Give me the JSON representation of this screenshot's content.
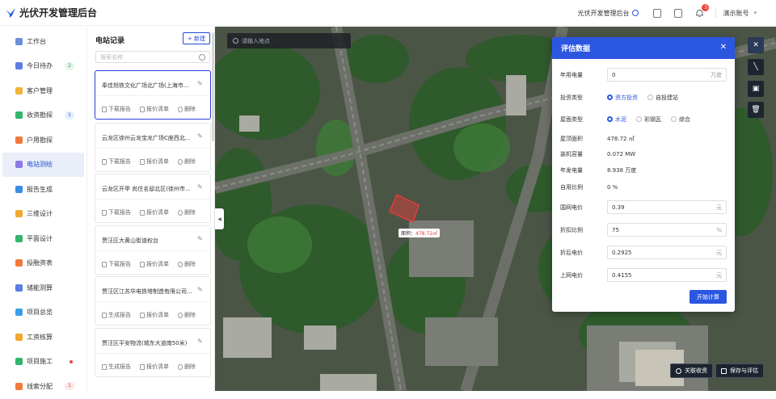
{
  "header": {
    "app_title": "光伏开发管理后台",
    "link_label": "光伏开发管理后台",
    "notification_count": "3",
    "user_name": "演示账号"
  },
  "sidebar": {
    "items": [
      {
        "label": "工作台",
        "color": "#6c8ed8",
        "badge": ""
      },
      {
        "label": "今日待办",
        "color": "#5b7ee6",
        "badge": "2",
        "badge_kind": "green"
      },
      {
        "label": "客户管理",
        "color": "#f0b33a",
        "badge": ""
      },
      {
        "label": "收资勘探",
        "color": "#35b56a",
        "badge": "1",
        "badge_kind": "blue"
      },
      {
        "label": "户用勘探",
        "color": "#f07a3a",
        "badge": ""
      },
      {
        "label": "电站测绘",
        "color": "#8a7be6",
        "badge": "",
        "active": true
      },
      {
        "label": "报告生成",
        "color": "#3a8ee6",
        "badge": ""
      },
      {
        "label": "三维设计",
        "color": "#f0a830",
        "badge": ""
      },
      {
        "label": "平面设计",
        "color": "#35b56a",
        "badge": ""
      },
      {
        "label": "投融资表",
        "color": "#f07a3a",
        "badge": ""
      },
      {
        "label": "储能测算",
        "color": "#5b7ee6",
        "badge": ""
      },
      {
        "label": "项目总览",
        "color": "#3aa0e6",
        "badge": ""
      },
      {
        "label": "工资核算",
        "color": "#f0a830",
        "badge": ""
      },
      {
        "label": "项目施工",
        "color": "#35b56a",
        "badge": "",
        "dot": true
      },
      {
        "label": "线索分配",
        "color": "#f07a3a",
        "badge": "1",
        "badge_kind": "red"
      }
    ]
  },
  "records": {
    "title": "电站记录",
    "new_label": "+ 新建",
    "search_placeholder": "搜索名称",
    "actions": {
      "download": "下载报告",
      "quote": "报价清单",
      "delete": "删除",
      "generate": "生成报告"
    },
    "items": [
      {
        "name": "奉佳旭铁文化广场北广场(上海市...",
        "first": "下载报告"
      },
      {
        "name": "云龙区徐州云龙宝龙广场C座西北...",
        "first": "下载报告"
      },
      {
        "name": "云龙区开甲 尚住名邸北区(徐州市...",
        "first": "下载报告"
      },
      {
        "name": "贾汪区大黄山街道权台",
        "first": "下载报告"
      },
      {
        "name": "贾汪区江苏华电铁塔制造有限公司...",
        "first": "生成报告"
      },
      {
        "name": "贾汪区平安物流(城东大道南50米)",
        "first": "生成报告"
      }
    ]
  },
  "map": {
    "search_placeholder": "请输入地点",
    "area_label": "面积：",
    "area_value": "478.72㎡",
    "tools": [
      "polygon-tool",
      "line-tool",
      "rect-tool",
      "delete-tool"
    ],
    "bottom_buttons": {
      "close_edge": "关联收资",
      "save": "保存与评估"
    }
  },
  "dialog": {
    "title": "评估数据",
    "fields": {
      "annual_power": {
        "label": "年用电量",
        "value": "0",
        "unit": "万度"
      },
      "invest_type": {
        "label": "投资类型",
        "options": [
          "资方投资",
          "自投建站"
        ],
        "selected": 0
      },
      "roof_type": {
        "label": "屋面类型",
        "options": [
          "水泥",
          "彩钢瓦",
          "综合"
        ],
        "selected": 0
      },
      "roof_area": {
        "label": "屋顶面积",
        "value": "478.72 ㎡"
      },
      "capacity": {
        "label": "装机容量",
        "value": "0.072 MW"
      },
      "annual_gen": {
        "label": "年发电量",
        "value": "8.938 万度"
      },
      "self_use": {
        "label": "自用比例",
        "value": "0 %"
      },
      "grid_price": {
        "label": "国网电价",
        "value": "0.39",
        "unit": "元"
      },
      "discount": {
        "label": "折扣比例",
        "value": "75",
        "unit": "%"
      },
      "discount_price": {
        "label": "折后电价",
        "value": "0.2925",
        "unit": "元"
      },
      "feed_price": {
        "label": "上网电价",
        "value": "0.4155",
        "unit": "元"
      }
    },
    "start_label": "开始计算"
  },
  "colors": {
    "primary": "#2b56e0",
    "active_nav_bg": "#e9eef8",
    "danger": "#f0413c"
  }
}
